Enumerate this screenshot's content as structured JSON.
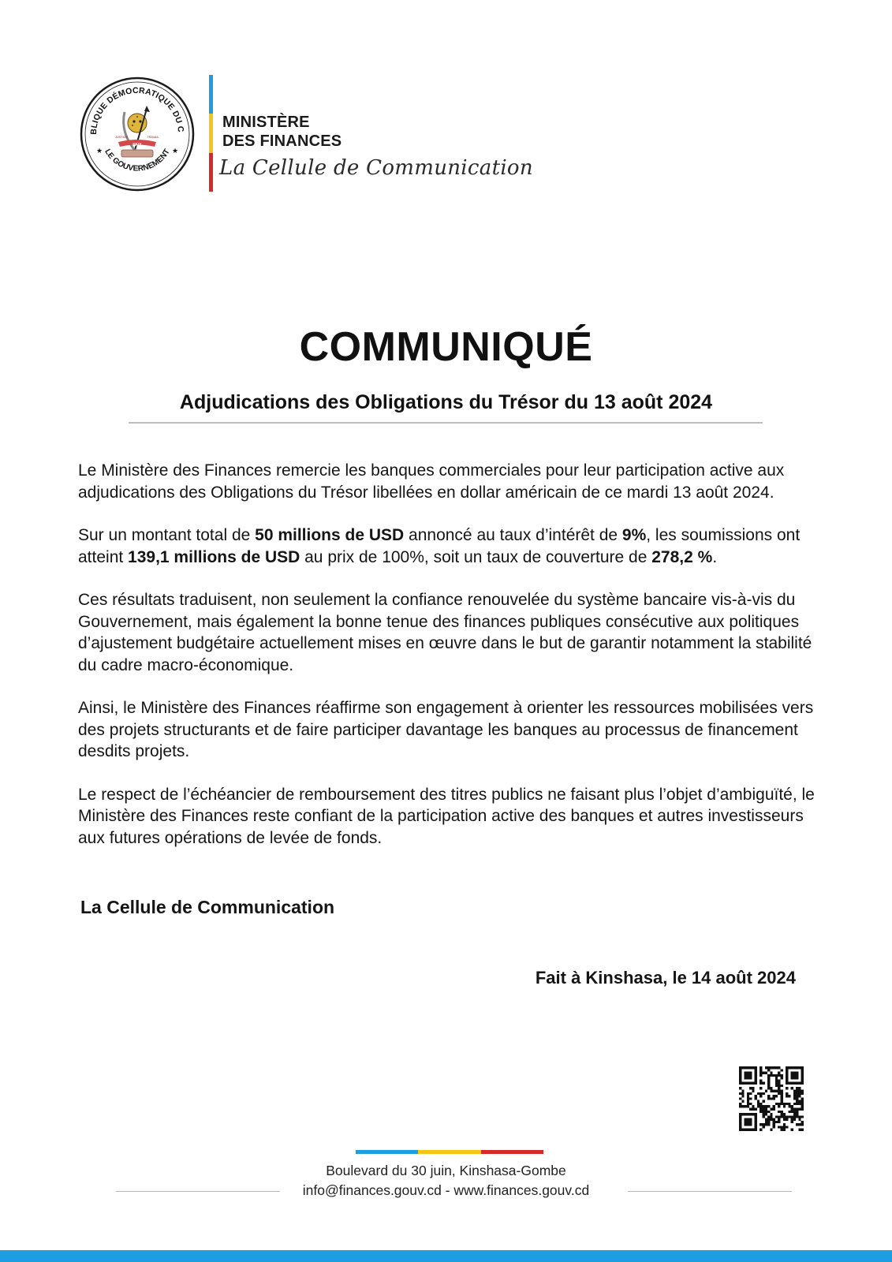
{
  "colors": {
    "blue": "#1e9ee0",
    "yellow": "#f5c518",
    "red": "#d42a2a",
    "band": "#1e9ee0"
  },
  "header": {
    "seal": {
      "arc_top": "RÉPUBLIQUE DÉMOCRATIQUE DU CONGO",
      "arc_bottom": "LE GOUVERNEMENT",
      "motto_left": "JUSTICE",
      "motto_center": "PAIX",
      "motto_right": "TRAVAIL"
    },
    "ministry_line1": "MINISTÈRE",
    "ministry_line2": "DES FINANCES",
    "cellule": "La Cellule de Communication"
  },
  "title": "COMMUNIQUÉ",
  "subtitle": "Adjudications des Obligations du Trésor du 13 août 2024",
  "paragraphs": {
    "p1": "Le Ministère des Finances remercie les banques commerciales pour leur participation active aux adjudications des Obligations du Trésor libellées en dollar américain de ce mardi 13 août 2024.",
    "p2": {
      "t1": "Sur un montant total de ",
      "b1": "50 millions de USD",
      "t2": " annoncé au taux d’intérêt de ",
      "b2": "9%",
      "t3": ", les soumissions ont atteint ",
      "b3": "139,1 millions de USD",
      "t4": " au prix de 100%, soit un taux de couverture de ",
      "b4": "278,2 %",
      "t5": "."
    },
    "p3": "Ces résultats traduisent, non seulement la confiance renouvelée du système bancaire vis-à-vis du Gouvernement, mais également la bonne tenue des finances publiques consécutive aux politiques d’ajustement budgétaire actuellement mises en œuvre dans le but de garantir notamment la stabilité du cadre macro-économique.",
    "p4": "Ainsi, le Ministère des Finances réaffirme son engagement à orienter les ressources mobilisées vers des projets structurants et de faire participer davantage les banques au processus de financement desdits projets.",
    "p5": "Le respect de l’échéancier de remboursement des titres publics ne faisant plus l’objet d’ambiguïté, le Ministère des Finances reste confiant de la participation active des banques et autres investisseurs aux futures opérations de levée de fonds."
  },
  "signature": "La Cellule de Communication",
  "place_date": "Fait à Kinshasa, le 14 août 2024",
  "footer": {
    "address": "Boulevard du 30 juin, Kinshasa-Gombe",
    "contacts": "info@finances.gouv.cd - www.finances.gouv.cd"
  },
  "icons": {
    "seal": "coat-of-arms-seal-icon",
    "qr": "qr-code-icon"
  }
}
